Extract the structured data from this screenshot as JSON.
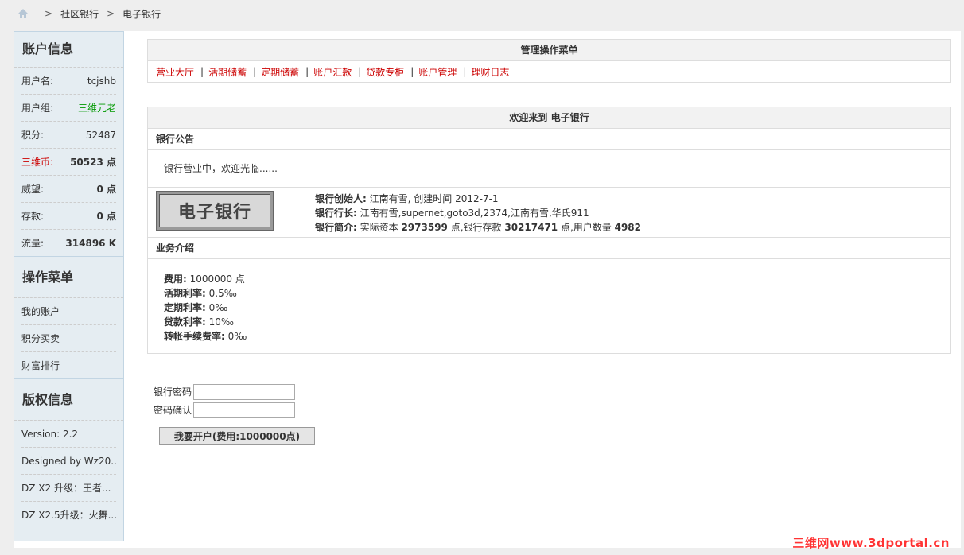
{
  "breadcrumb": {
    "items": [
      "社区银行",
      "电子银行"
    ]
  },
  "sidebar": {
    "account": {
      "title": "账户信息",
      "rows": [
        {
          "label": "用户名:",
          "value": "tcjshb"
        },
        {
          "label": "用户组:",
          "value": "三维元老"
        },
        {
          "label": "积分:",
          "value": "52487"
        },
        {
          "label": "三维币:",
          "value": "50523 点"
        },
        {
          "label": "威望:",
          "value": "0 点"
        },
        {
          "label": "存款:",
          "value": "0 点"
        },
        {
          "label": "流量:",
          "value": "314896 K"
        }
      ]
    },
    "ops": {
      "title": "操作菜单",
      "items": [
        "我的账户",
        "积分买卖",
        "财富排行"
      ]
    },
    "copyright": {
      "title": "版权信息",
      "items": [
        "Version: 2.2",
        "Designed by Wz20...",
        "DZ X2 升级：王者...",
        "DZ X2.5升级：火舞..."
      ]
    }
  },
  "admin_menu": {
    "title": "管理操作菜单",
    "items": [
      "营业大厅",
      "活期储蓄",
      "定期储蓄",
      "账户汇款",
      "贷款专柜",
      "账户管理",
      "理财日志"
    ]
  },
  "welcome": {
    "title": "欢迎来到 电子银行",
    "notice_title": "银行公告",
    "notice_text": "银行营业中，欢迎光临......",
    "logo_text": "电子银行",
    "founder_label": "银行创始人:",
    "founder_value": " 江南有雪, 创建时间 2012-7-1",
    "manager_label": "银行行长:",
    "manager_value": " 江南有雪,supernet,goto3d,2374,江南有雪,华氏911",
    "intro_label": "银行简介:",
    "intro_pre": " 实际资本 ",
    "capital": "2973599",
    "intro_mid": " 点,银行存款 ",
    "deposit": "30217471",
    "intro_mid2": " 点,用户数量 ",
    "users": "4982",
    "business_title": "业务介绍",
    "business": [
      {
        "label": "费用:",
        "value": " 1000000 点"
      },
      {
        "label": "活期利率:",
        "value": " 0.5‰"
      },
      {
        "label": "定期利率:",
        "value": " 0‰"
      },
      {
        "label": "贷款利率:",
        "value": " 10‰"
      },
      {
        "label": "转帐手续费率:",
        "value": " 0‰"
      }
    ]
  },
  "form": {
    "password_label": "银行密码",
    "confirm_label": "密码确认",
    "password_value": "",
    "confirm_value": "",
    "submit_label": "我要开户(费用:1000000点)"
  },
  "watermark": "三维网www.3dportal.cn",
  "colors": {
    "link_red": "#cc0000",
    "group_green": "#009900",
    "sidebar_bg": "#e5edf2"
  }
}
